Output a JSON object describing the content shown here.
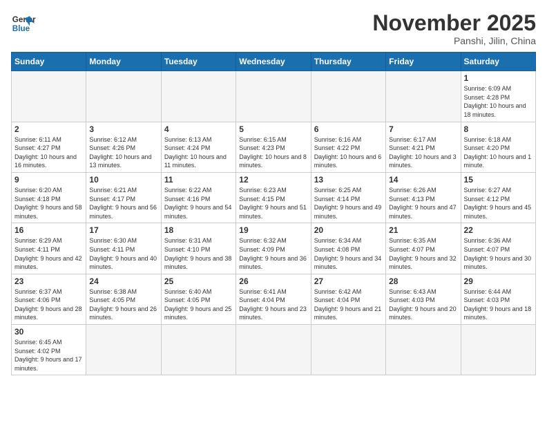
{
  "header": {
    "logo_general": "General",
    "logo_blue": "Blue",
    "title": "November 2025",
    "subtitle": "Panshi, Jilin, China"
  },
  "weekdays": [
    "Sunday",
    "Monday",
    "Tuesday",
    "Wednesday",
    "Thursday",
    "Friday",
    "Saturday"
  ],
  "days": [
    {
      "date": "",
      "info": ""
    },
    {
      "date": "",
      "info": ""
    },
    {
      "date": "",
      "info": ""
    },
    {
      "date": "",
      "info": ""
    },
    {
      "date": "",
      "info": ""
    },
    {
      "date": "",
      "info": ""
    },
    {
      "date": "1",
      "info": "Sunrise: 6:09 AM\nSunset: 4:28 PM\nDaylight: 10 hours and 18 minutes."
    },
    {
      "date": "2",
      "info": "Sunrise: 6:11 AM\nSunset: 4:27 PM\nDaylight: 10 hours and 16 minutes."
    },
    {
      "date": "3",
      "info": "Sunrise: 6:12 AM\nSunset: 4:26 PM\nDaylight: 10 hours and 13 minutes."
    },
    {
      "date": "4",
      "info": "Sunrise: 6:13 AM\nSunset: 4:24 PM\nDaylight: 10 hours and 11 minutes."
    },
    {
      "date": "5",
      "info": "Sunrise: 6:15 AM\nSunset: 4:23 PM\nDaylight: 10 hours and 8 minutes."
    },
    {
      "date": "6",
      "info": "Sunrise: 6:16 AM\nSunset: 4:22 PM\nDaylight: 10 hours and 6 minutes."
    },
    {
      "date": "7",
      "info": "Sunrise: 6:17 AM\nSunset: 4:21 PM\nDaylight: 10 hours and 3 minutes."
    },
    {
      "date": "8",
      "info": "Sunrise: 6:18 AM\nSunset: 4:20 PM\nDaylight: 10 hours and 1 minute."
    },
    {
      "date": "9",
      "info": "Sunrise: 6:20 AM\nSunset: 4:18 PM\nDaylight: 9 hours and 58 minutes."
    },
    {
      "date": "10",
      "info": "Sunrise: 6:21 AM\nSunset: 4:17 PM\nDaylight: 9 hours and 56 minutes."
    },
    {
      "date": "11",
      "info": "Sunrise: 6:22 AM\nSunset: 4:16 PM\nDaylight: 9 hours and 54 minutes."
    },
    {
      "date": "12",
      "info": "Sunrise: 6:23 AM\nSunset: 4:15 PM\nDaylight: 9 hours and 51 minutes."
    },
    {
      "date": "13",
      "info": "Sunrise: 6:25 AM\nSunset: 4:14 PM\nDaylight: 9 hours and 49 minutes."
    },
    {
      "date": "14",
      "info": "Sunrise: 6:26 AM\nSunset: 4:13 PM\nDaylight: 9 hours and 47 minutes."
    },
    {
      "date": "15",
      "info": "Sunrise: 6:27 AM\nSunset: 4:12 PM\nDaylight: 9 hours and 45 minutes."
    },
    {
      "date": "16",
      "info": "Sunrise: 6:29 AM\nSunset: 4:11 PM\nDaylight: 9 hours and 42 minutes."
    },
    {
      "date": "17",
      "info": "Sunrise: 6:30 AM\nSunset: 4:11 PM\nDaylight: 9 hours and 40 minutes."
    },
    {
      "date": "18",
      "info": "Sunrise: 6:31 AM\nSunset: 4:10 PM\nDaylight: 9 hours and 38 minutes."
    },
    {
      "date": "19",
      "info": "Sunrise: 6:32 AM\nSunset: 4:09 PM\nDaylight: 9 hours and 36 minutes."
    },
    {
      "date": "20",
      "info": "Sunrise: 6:34 AM\nSunset: 4:08 PM\nDaylight: 9 hours and 34 minutes."
    },
    {
      "date": "21",
      "info": "Sunrise: 6:35 AM\nSunset: 4:07 PM\nDaylight: 9 hours and 32 minutes."
    },
    {
      "date": "22",
      "info": "Sunrise: 6:36 AM\nSunset: 4:07 PM\nDaylight: 9 hours and 30 minutes."
    },
    {
      "date": "23",
      "info": "Sunrise: 6:37 AM\nSunset: 4:06 PM\nDaylight: 9 hours and 28 minutes."
    },
    {
      "date": "24",
      "info": "Sunrise: 6:38 AM\nSunset: 4:05 PM\nDaylight: 9 hours and 26 minutes."
    },
    {
      "date": "25",
      "info": "Sunrise: 6:40 AM\nSunset: 4:05 PM\nDaylight: 9 hours and 25 minutes."
    },
    {
      "date": "26",
      "info": "Sunrise: 6:41 AM\nSunset: 4:04 PM\nDaylight: 9 hours and 23 minutes."
    },
    {
      "date": "27",
      "info": "Sunrise: 6:42 AM\nSunset: 4:04 PM\nDaylight: 9 hours and 21 minutes."
    },
    {
      "date": "28",
      "info": "Sunrise: 6:43 AM\nSunset: 4:03 PM\nDaylight: 9 hours and 20 minutes."
    },
    {
      "date": "29",
      "info": "Sunrise: 6:44 AM\nSunset: 4:03 PM\nDaylight: 9 hours and 18 minutes."
    },
    {
      "date": "30",
      "info": "Sunrise: 6:45 AM\nSunset: 4:02 PM\nDaylight: 9 hours and 17 minutes."
    },
    {
      "date": "",
      "info": ""
    },
    {
      "date": "",
      "info": ""
    },
    {
      "date": "",
      "info": ""
    },
    {
      "date": "",
      "info": ""
    },
    {
      "date": "",
      "info": ""
    },
    {
      "date": "",
      "info": ""
    }
  ]
}
